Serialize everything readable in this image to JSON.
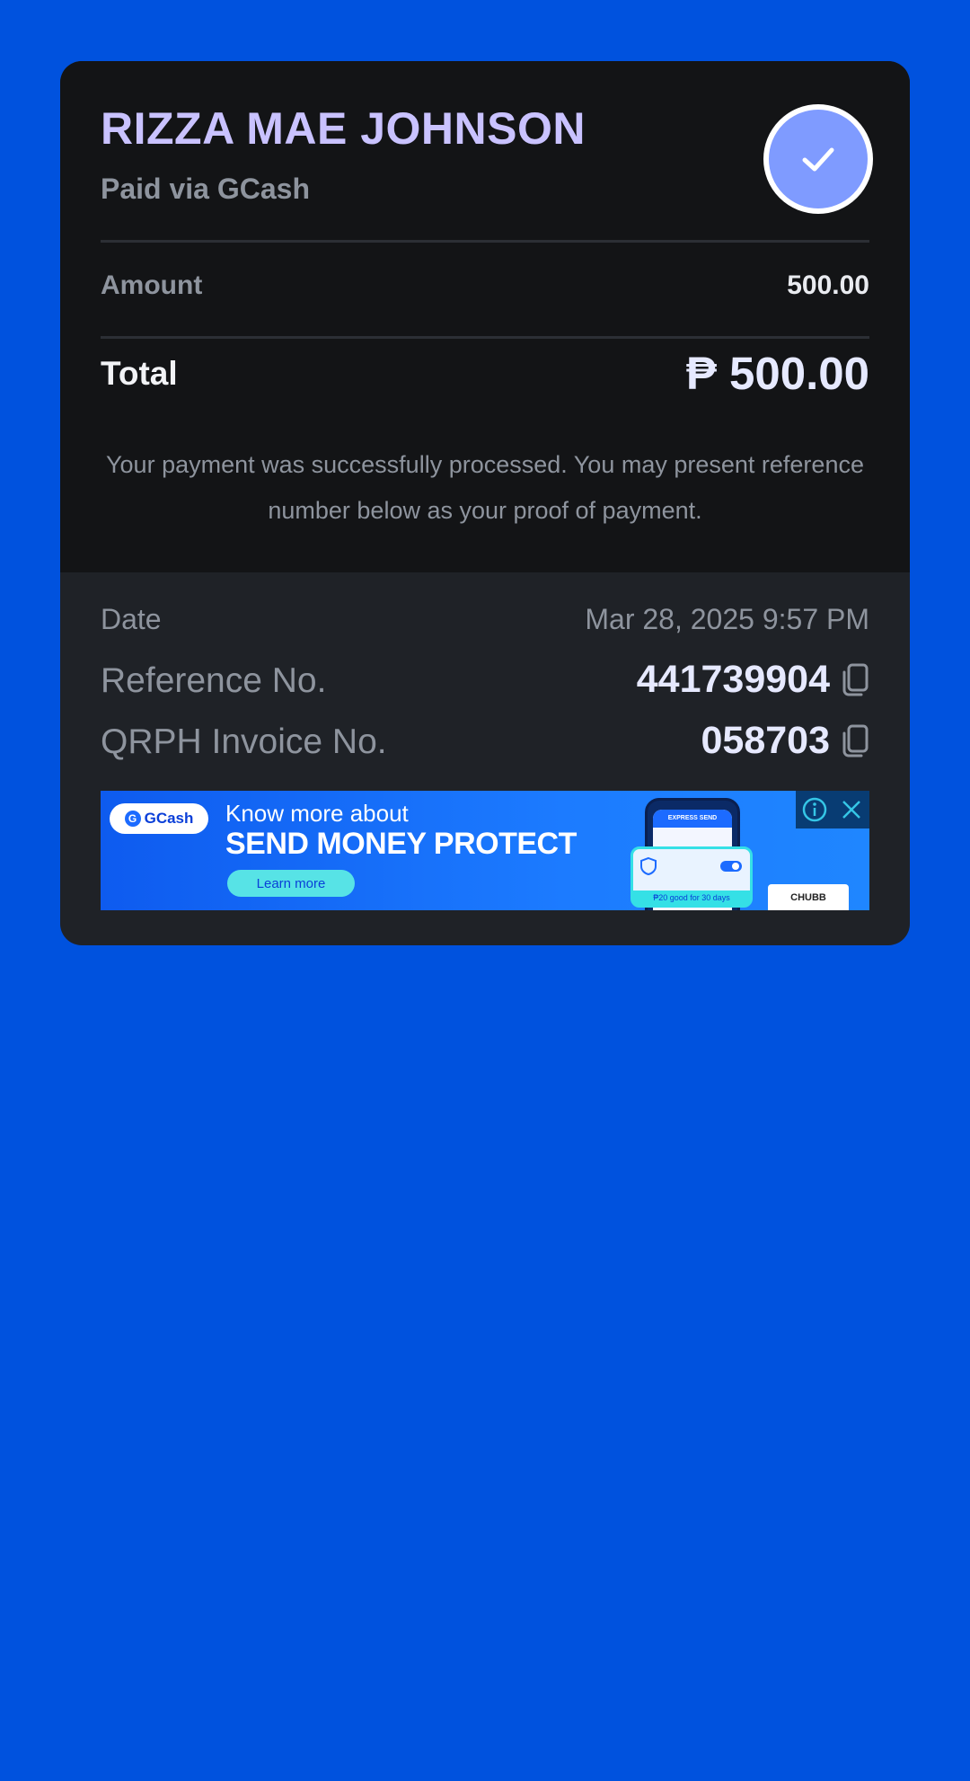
{
  "receipt": {
    "merchant_name": "RIZZA MAE JOHNSON",
    "paid_via": "Paid via GCash",
    "amount_label": "Amount",
    "amount_value": "500.00",
    "total_label": "Total",
    "total_value": "₱ 500.00",
    "success_message": "Your payment was successfully processed. You may present reference number below as your proof of payment.",
    "date_label": "Date",
    "date_value": "Mar 28, 2025 9:57 PM",
    "reference_label": "Reference No.",
    "reference_value": "441739904",
    "invoice_label": "QRPH Invoice No.",
    "invoice_value": "058703"
  },
  "banner": {
    "brand": "GCash",
    "line1": "Know more about",
    "line2": "SEND MONEY PROTECT",
    "cta": "Learn more",
    "phone_header": "EXPRESS SEND",
    "promo_foot": "₱20 good for 30 days",
    "partner": "CHUBB"
  },
  "colors": {
    "background": "#0052DE",
    "card_top": "#131416",
    "card_bottom": "#1F2227",
    "accent": "#7F9BFF",
    "name": "#C9C2FF"
  },
  "icons": {
    "status": "check-icon",
    "copy": "copy-icon",
    "info": "info-icon",
    "close": "close-icon"
  }
}
